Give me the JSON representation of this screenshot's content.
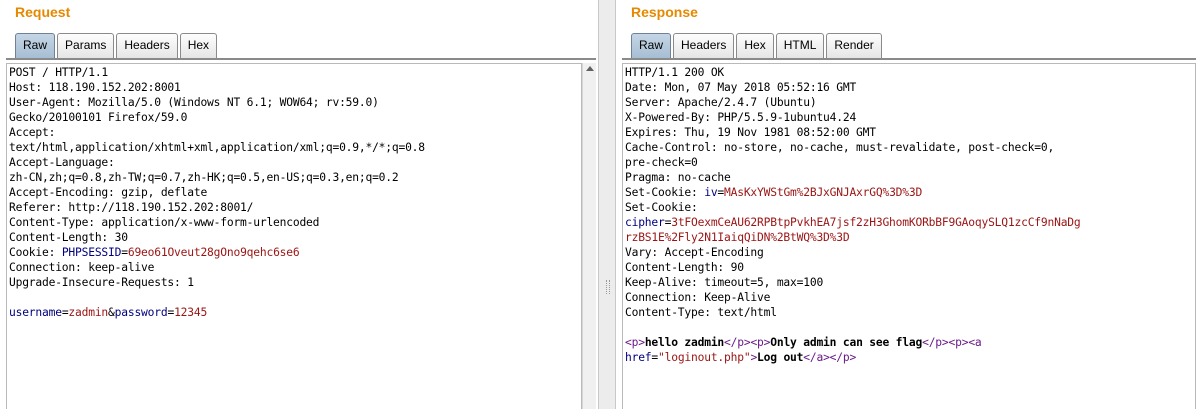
{
  "request": {
    "title": "Request",
    "tabs": [
      "Raw",
      "Params",
      "Headers",
      "Hex"
    ],
    "active_tab": "Raw",
    "lines": [
      "POST / HTTP/1.1",
      "Host: 118.190.152.202:8001",
      "User-Agent: Mozilla/5.0 (Windows NT 6.1; WOW64; rv:59.0)",
      "Gecko/20100101 Firefox/59.0",
      "Accept:",
      "text/html,application/xhtml+xml,application/xml;q=0.9,*/*;q=0.8",
      "Accept-Language:",
      "zh-CN,zh;q=0.8,zh-TW;q=0.7,zh-HK;q=0.5,en-US;q=0.3,en;q=0.2",
      "Accept-Encoding: gzip, deflate",
      "Referer: http://118.190.152.202:8001/",
      "Content-Type: application/x-www-form-urlencoded",
      "Content-Length: 30"
    ],
    "cookie": {
      "label": "Cookie: ",
      "name": "PHPSESSID",
      "eq": "=",
      "value": "69eo61Oveut28gOno9qehc6se6"
    },
    "lines_after_cookie": [
      "Connection: keep-alive",
      "Upgrade-Insecure-Requests: 1"
    ],
    "body": {
      "param1_name": "username",
      "eq1": "=",
      "param1_value": "zadmin",
      "amp": "&",
      "param2_name": "password",
      "eq2": "=",
      "param2_value": "12345"
    }
  },
  "response": {
    "title": "Response",
    "tabs": [
      "Raw",
      "Headers",
      "Hex",
      "HTML",
      "Render"
    ],
    "active_tab": "Raw",
    "lines": [
      "HTTP/1.1 200 OK",
      "Date: Mon, 07 May 2018 05:52:16 GMT",
      "Server: Apache/2.4.7 (Ubuntu)",
      "X-Powered-By: PHP/5.5.9-1ubuntu4.24",
      "Expires: Thu, 19 Nov 1981 08:52:00 GMT",
      "Cache-Control: no-store, no-cache, must-revalidate, post-check=0,",
      "pre-check=0",
      "Pragma: no-cache"
    ],
    "set_cookie_1": {
      "label": "Set-Cookie: ",
      "name": "iv",
      "eq": "=",
      "value": "MAsKxYWStGm%2BJxGNJAxrGQ%3D%3D"
    },
    "set_cookie_2": {
      "label": "Set-Cookie:",
      "name": "cipher",
      "eq": "=",
      "value_line1": "3tFOexmCeAU62RPBtpPvkhEA7jsf2zH3GhomKORbBF9GAoqySLQ1zcCf9nNaDg",
      "value_line2": "rzBS1E%2Fly2N1IaiqQiDN%2BtWQ%3D%3D"
    },
    "lines_after_cookie": [
      "Vary: Accept-Encoding",
      "Content-Length: 90",
      "Keep-Alive: timeout=5, max=100",
      "Connection: Keep-Alive",
      "Content-Type: text/html"
    ],
    "html_body": {
      "p_open": "<p>",
      "p_close": "</p>",
      "text1": "hello zadmin",
      "text2": "Only admin can see flag",
      "a_open": "<a",
      "href_attr": "href",
      "href_eq": "=",
      "href_value": "\"loginout.php\"",
      "tag_end": ">",
      "link_text": "Log out",
      "a_close": "</a>"
    }
  }
}
